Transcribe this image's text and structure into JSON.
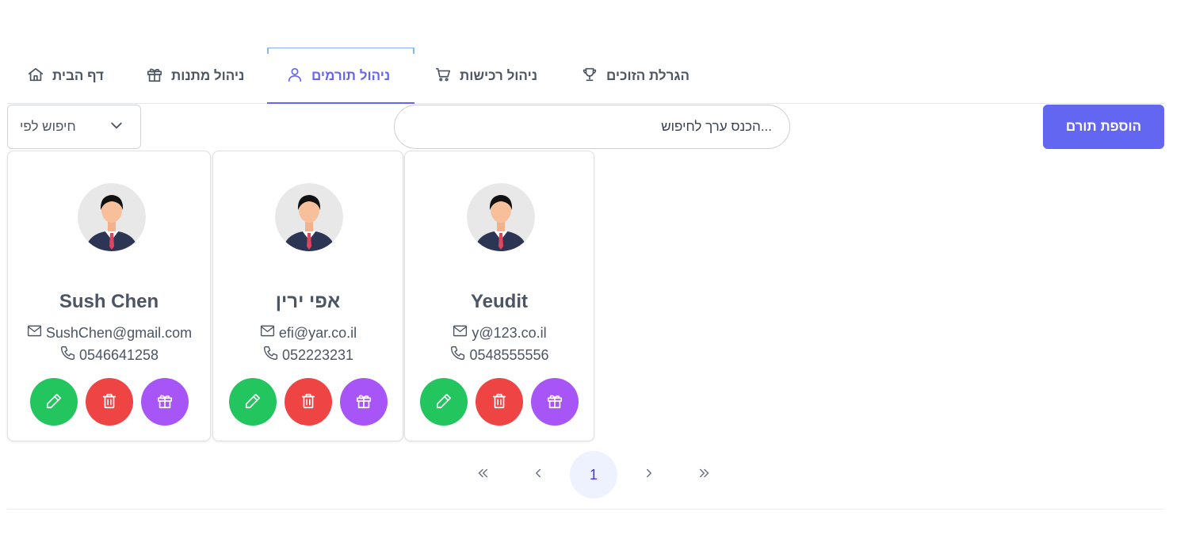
{
  "tabs": [
    {
      "label": "הגרלת הזוכים",
      "icon": "trophy-icon",
      "active": false
    },
    {
      "label": "ניהול רכישות",
      "icon": "cart-icon",
      "active": false
    },
    {
      "label": "ניהול תורמים",
      "icon": "user-icon",
      "active": true
    },
    {
      "label": "ניהול מתנות",
      "icon": "gift-icon",
      "active": false
    },
    {
      "label": "דף הבית",
      "icon": "home-icon",
      "active": false
    }
  ],
  "toolbar": {
    "add_label": "הוספת תורם",
    "search_placeholder": "...הכנס ערך לחיפוש",
    "search_by_label": "חיפוש לפי"
  },
  "donors": [
    {
      "name": "Sush Chen",
      "email": "SushChen@gmail.com",
      "phone": "0546641258"
    },
    {
      "name": "אפי ירין",
      "email": "efi@yar.co.il",
      "phone": "052223231"
    },
    {
      "name": "Yeudit",
      "email": "y@123.co.il",
      "phone": "0548555556"
    }
  ],
  "pagination": {
    "current_page": "1"
  },
  "colors": {
    "accent": "#6366f1",
    "edit": "#22c55e",
    "delete": "#ef4444",
    "gift": "#a855f7"
  }
}
